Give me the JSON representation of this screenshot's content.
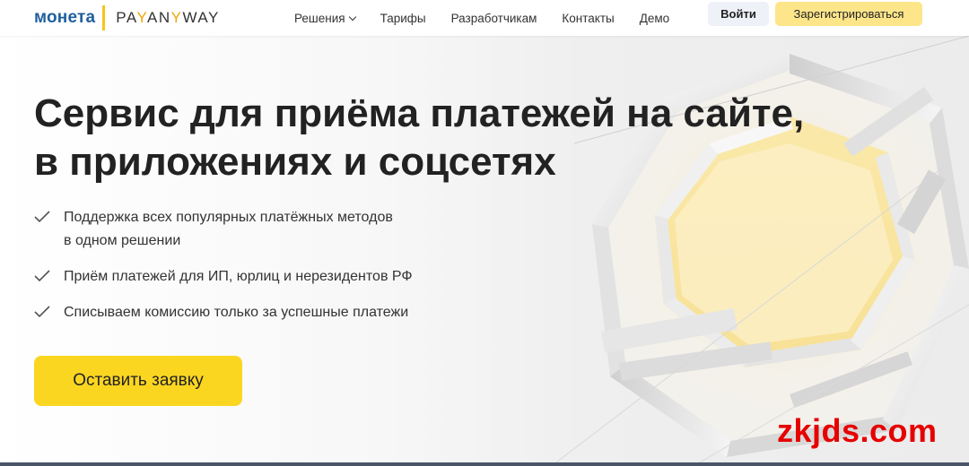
{
  "header": {
    "logo": {
      "moneta": "монета",
      "payanyway_pre": "PA",
      "payanyway_y1": "Y",
      "payanyway_mid": "AN",
      "payanyway_y2": "Y",
      "payanyway_post": "WAY"
    },
    "nav": [
      {
        "label": "Решения",
        "has_dropdown": true
      },
      {
        "label": "Тарифы"
      },
      {
        "label": "Разработчикам"
      },
      {
        "label": "Контакты"
      },
      {
        "label": "Демо"
      }
    ],
    "login_label": "Войти",
    "register_label": "Зарегистрироваться"
  },
  "hero": {
    "title_line1": "Сервис для приёма платежей на сайте,",
    "title_line2": "в приложениях и соцсетях",
    "features": [
      {
        "line1": "Поддержка всех популярных платёжных методов",
        "line2": "в одном решении"
      },
      {
        "line1": "Приём платежей для ИП, юрлиц и нерезидентов РФ"
      },
      {
        "line1": "Списываем комиссию только за успешные платежи"
      }
    ],
    "cta_label": "Оставить заявку"
  },
  "watermark": "zkjds.com",
  "colors": {
    "brand_blue": "#1f5f9e",
    "accent_yellow": "#fbd621",
    "register_yellow": "#fde58a",
    "login_bg": "#eef1f7",
    "watermark_red": "#e60000"
  },
  "icons": {
    "check": "check-icon",
    "dropdown": "chevron-down-icon"
  }
}
